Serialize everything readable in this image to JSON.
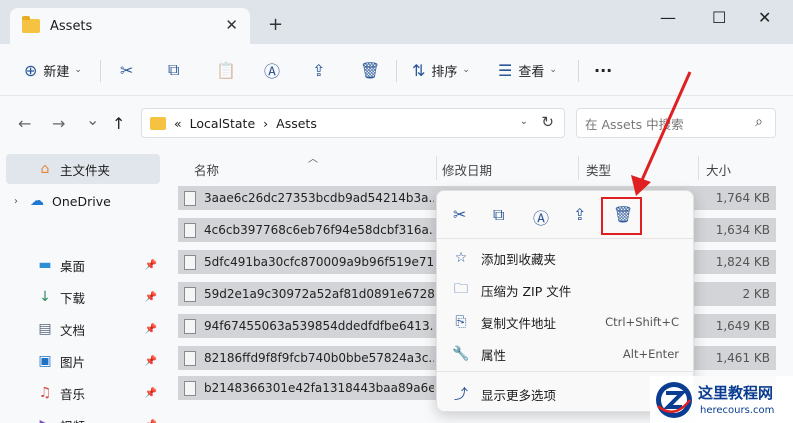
{
  "window": {
    "tab_title": "Assets",
    "tab_close": "✕",
    "new_tab": "+",
    "minimize": "—",
    "maximize": "☐",
    "close": "✕"
  },
  "toolbar": {
    "new_label": "新建",
    "sort_label": "排序",
    "view_label": "查看",
    "more": "···"
  },
  "nav": {
    "back": "←",
    "forward": "→",
    "recent": "⌄",
    "up": "↑"
  },
  "address": {
    "prefix": "«",
    "crumbs": [
      "LocalState",
      "Assets"
    ],
    "sep": "›"
  },
  "search": {
    "placeholder": "在 Assets 中搜索"
  },
  "sidebar": {
    "home": "主文件夹",
    "onedrive": "OneDrive",
    "items": [
      {
        "label": "桌面",
        "icon": "desktop-icon"
      },
      {
        "label": "下载",
        "icon": "download-icon"
      },
      {
        "label": "文档",
        "icon": "document-icon"
      },
      {
        "label": "图片",
        "icon": "picture-icon"
      },
      {
        "label": "音乐",
        "icon": "music-icon"
      },
      {
        "label": "视频",
        "icon": "video-icon"
      }
    ]
  },
  "columns": {
    "name": "名称",
    "date": "修改日期",
    "type": "类型",
    "size": "大小"
  },
  "files": [
    {
      "name": "3aae6c26dc27353bcdb9ad54214b3a...",
      "size": "1,764 KB"
    },
    {
      "name": "4c6cb397768c6eb76f94e58dcbf316a...",
      "size": "1,634 KB"
    },
    {
      "name": "5dfc491ba30cfc870009a9b96f519e71...",
      "size": "1,824 KB"
    },
    {
      "name": "59d2e1a9c30972a52af81d0891e6728...",
      "size": "2 KB"
    },
    {
      "name": "94f67455063a539854ddedfdfbe6413...",
      "size": "1,649 KB"
    },
    {
      "name": "82186ffd9f8f9fcb740b0bbe57824a3c...",
      "size": "1,461 KB"
    },
    {
      "name": "b2148366301e42fa1318443baa89a6e...",
      "size": ""
    }
  ],
  "context_menu": {
    "items": [
      {
        "label": "添加到收藏夹",
        "shortcut": "",
        "icon": "star-icon"
      },
      {
        "label": "压缩为 ZIP 文件",
        "shortcut": "",
        "icon": "zip-icon"
      },
      {
        "label": "复制文件地址",
        "shortcut": "Ctrl+Shift+C",
        "icon": "path-icon"
      },
      {
        "label": "属性",
        "shortcut": "Alt+Enter",
        "icon": "wrench-icon"
      }
    ],
    "more_options": "显示更多选项"
  },
  "watermark": {
    "title": "这里教程网",
    "url": "herecours.com"
  },
  "colors": {
    "accent": "#2b5797",
    "highlight": "#e02020",
    "selection": "#d2d4d7"
  }
}
